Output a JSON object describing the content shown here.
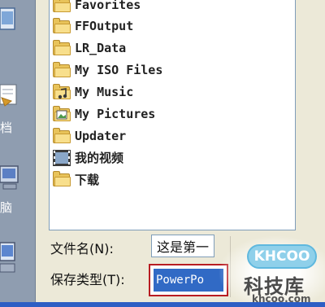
{
  "places_bar": {
    "items": [
      {
        "label": "",
        "icon": "desktop-icon"
      },
      {
        "label": "档",
        "icon": "my-documents-icon"
      },
      {
        "label": "脑",
        "icon": "my-computer-icon"
      },
      {
        "label": "",
        "icon": "network-places-icon"
      }
    ]
  },
  "file_list": {
    "items": [
      {
        "name": "Favorites",
        "icon": "folder-icon"
      },
      {
        "name": "FFOutput",
        "icon": "folder-icon"
      },
      {
        "name": "LR_Data",
        "icon": "folder-icon"
      },
      {
        "name": "My ISO Files",
        "icon": "folder-icon"
      },
      {
        "name": "My Music",
        "icon": "music-folder-icon"
      },
      {
        "name": "My Pictures",
        "icon": "pictures-folder-icon"
      },
      {
        "name": "Updater",
        "icon": "folder-icon"
      },
      {
        "name": "我的视频",
        "icon": "video-folder-icon"
      },
      {
        "name": "下载",
        "icon": "folder-icon"
      }
    ]
  },
  "form": {
    "filename_label": "文件名(N):",
    "filename_value": "这是第一",
    "filetype_label": "保存类型(T):",
    "filetype_value": "PowerPo"
  },
  "watermark": {
    "badge": "KHCOO",
    "name": "科技库",
    "url": "khcoo.com"
  },
  "colors": {
    "selection": "#316ac5",
    "highlight_border": "#b81c22",
    "folder": "#e8c35a"
  }
}
